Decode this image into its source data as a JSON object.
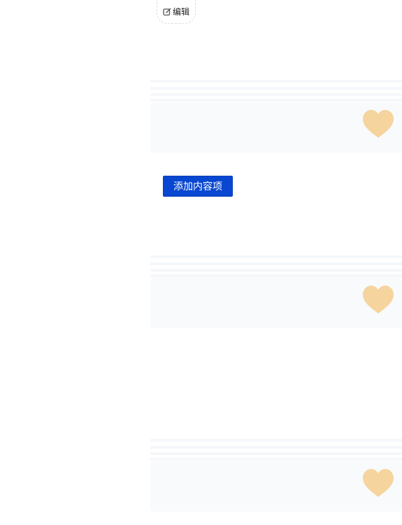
{
  "toolbar": {
    "edit_label": "编辑",
    "edit_icon": "edit-icon"
  },
  "actions": {
    "add_content_label": "添加内容项"
  },
  "cards": [
    {
      "icon": "heart-icon"
    },
    {
      "icon": "heart-icon"
    },
    {
      "icon": "heart-icon"
    }
  ],
  "colors": {
    "heart": "#f5d49d",
    "button": "#0847d1",
    "stripe": "#f5f7fa",
    "card": "#f8fafc"
  }
}
